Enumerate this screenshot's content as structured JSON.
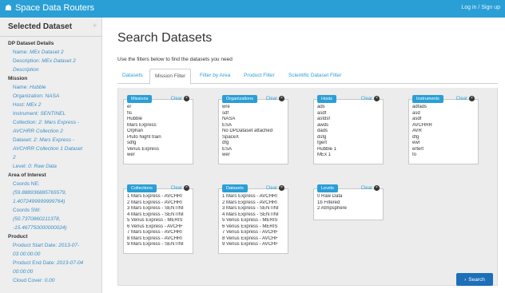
{
  "header": {
    "brand": "Space Data Routers",
    "login": "Log in / Sign up"
  },
  "sidebar": {
    "title": "Selected Dataset",
    "lines": [
      {
        "kind": "sec",
        "text": "DP Dataset Details"
      },
      {
        "kind": "fld",
        "label": "Name: ",
        "value": "MEx Dataset 2"
      },
      {
        "kind": "fld",
        "label": "Description: ",
        "value": "MEx Dataset 2"
      },
      {
        "kind": "fld",
        "label": "",
        "value": "Description"
      },
      {
        "kind": "sec",
        "text": "Mission"
      },
      {
        "kind": "fld",
        "label": "Name: ",
        "value": "Hubble"
      },
      {
        "kind": "fld",
        "label": "Organization: ",
        "value": "NASA"
      },
      {
        "kind": "fld",
        "label": "Host: ",
        "value": "MEx 2"
      },
      {
        "kind": "fld",
        "label": "Instrument: ",
        "value": "SENTINEL"
      },
      {
        "kind": "fld",
        "label": "Collection: ",
        "value": "2: Mars Express -"
      },
      {
        "kind": "fld",
        "label": "",
        "value": "AVCHRR Collection 2"
      },
      {
        "kind": "fld",
        "label": "Dataset: ",
        "value": "2: Mars Express -"
      },
      {
        "kind": "fld",
        "label": "",
        "value": "AVCHRR Collection 1 Dataset"
      },
      {
        "kind": "fld",
        "label": "",
        "value": "2"
      },
      {
        "kind": "fld",
        "label": "Level: ",
        "value": "0: Raw Data"
      },
      {
        "kind": "sec",
        "text": "Area of Interest"
      },
      {
        "kind": "fld",
        "label": "Coords NE:",
        "value": ""
      },
      {
        "kind": "fld",
        "label": "",
        "value": "(59.888936885765579,"
      },
      {
        "kind": "fld",
        "label": "",
        "value": "1.4072499999999764)"
      },
      {
        "kind": "fld",
        "label": "Coords SW:",
        "value": ""
      },
      {
        "kind": "fld",
        "label": "",
        "value": "(50.7370860211378,"
      },
      {
        "kind": "fld",
        "label": "",
        "value": "-15.467750000000024)"
      },
      {
        "kind": "sec",
        "text": "Product"
      },
      {
        "kind": "fld",
        "label": "Product Start Date: ",
        "value": "2013-07-"
      },
      {
        "kind": "fld",
        "label": "",
        "value": "03 00:00:00"
      },
      {
        "kind": "fld",
        "label": "Product End Date: ",
        "value": "2013-07-04"
      },
      {
        "kind": "fld",
        "label": "",
        "value": "00:00:00"
      },
      {
        "kind": "fld",
        "label": "Cloud Cover: ",
        "value": "0.00"
      }
    ]
  },
  "main": {
    "title": "Search Datasets",
    "intro": "Use the filters below to find the datasets you need",
    "tabs": [
      "Datasets",
      "Mission Filter",
      "Filter by Area",
      "Product Filter",
      "Scientific Dataset Filter"
    ],
    "active_tab": 1,
    "clear_label": "Clear",
    "search_label": "Search"
  },
  "filters": [
    {
      "name": "missions",
      "label": "Missions",
      "items": [
        "er",
        "fis",
        "Hubble",
        "Mars Express",
        "Orphan",
        "Pluto Night train",
        "sdfg",
        "Venus Express",
        "wer"
      ]
    },
    {
      "name": "organizations",
      "label": "Organizations",
      "items": [
        "wre",
        "sdf",
        "NASA",
        "ESA",
        "No DPDataset attached",
        "SpaceX",
        "dfg",
        "ESA",
        "wer"
      ]
    },
    {
      "name": "hosts",
      "label": "Hosts",
      "items": [
        "ads",
        "asdf",
        "asfdsf",
        "awds",
        "dads",
        "dsfg",
        "fgert",
        "Hubble 1",
        "MEx 1"
      ]
    },
    {
      "name": "instruments",
      "label": "Instruments",
      "items": [
        "adfads",
        "asd",
        "asdf",
        "AVCHRR",
        "AVR",
        "dfg",
        "ewr",
        "ertert",
        "fo"
      ]
    },
    {
      "name": "collections",
      "label": "Collections",
      "items": [
        "1 Mars Express - AVCHRI",
        "2 Mars Express - AVCHRI",
        "3 Mars Express - SENTINI",
        "4 Mars Express - SENTINI",
        "5 Venus Express - MERIS",
        "6 Venus Express - AVCHF",
        "7 Mars Express - AVCHRI",
        "8 Mars Express - AVCHRI",
        "9 Mars Express - SENTINI"
      ]
    },
    {
      "name": "datasets",
      "label": "Datasets",
      "items": [
        "1 Mars Express - AVCHRI",
        "2 Mars Express - AVCHRI",
        "3 Mars Express - SENTINI",
        "4 Mars Express - SENTINI",
        "5 Venus Express - MERIS",
        "6 Venus Express - MERIS",
        "7 Venus Express - AVCHF",
        "8 Venus Express - AVCHF",
        "9 Venus Express - AVCHF"
      ]
    },
    {
      "name": "levels",
      "label": "Levels",
      "items": [
        "0 Raw Data",
        "1b Filtered",
        "2 Atmpsphere"
      ]
    }
  ]
}
